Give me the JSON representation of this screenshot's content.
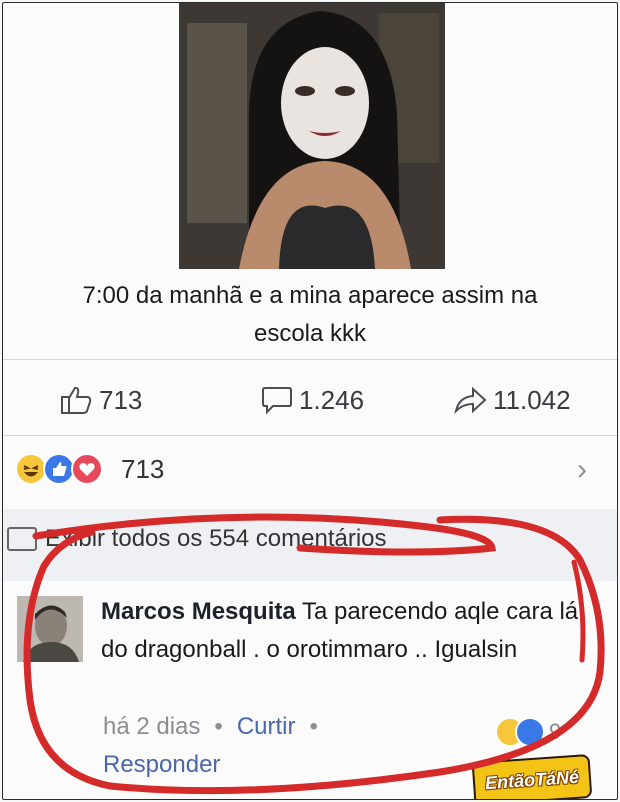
{
  "post": {
    "caption_line1": "7:00 da manhã e a mina aparece assim na",
    "caption_line2": "escola kkk",
    "photo_icon": "person-portrait-photo"
  },
  "actions": {
    "likes": "713",
    "comments": "1.246",
    "shares": "11.042"
  },
  "reactions": {
    "count": "713",
    "icons": [
      "haha-icon",
      "like-icon",
      "love-icon"
    ]
  },
  "comments_section": {
    "view_all_label": "Exibir todos os 554 comentários"
  },
  "comment": {
    "author": "Marcos Mesquita",
    "text": " Ta parecendo aqle cara lá do dragonball . o orotimmaro .. Igualsin",
    "time": "há 2 dias",
    "like_label": "Curtir",
    "reply_label": "Responder",
    "reaction_count": "9"
  },
  "watermark": {
    "text": "EntãoTáNé"
  },
  "colors": {
    "link": "#4a68a8",
    "annotation_red": "#d42a2a",
    "watermark_yellow": "#f3c316"
  }
}
